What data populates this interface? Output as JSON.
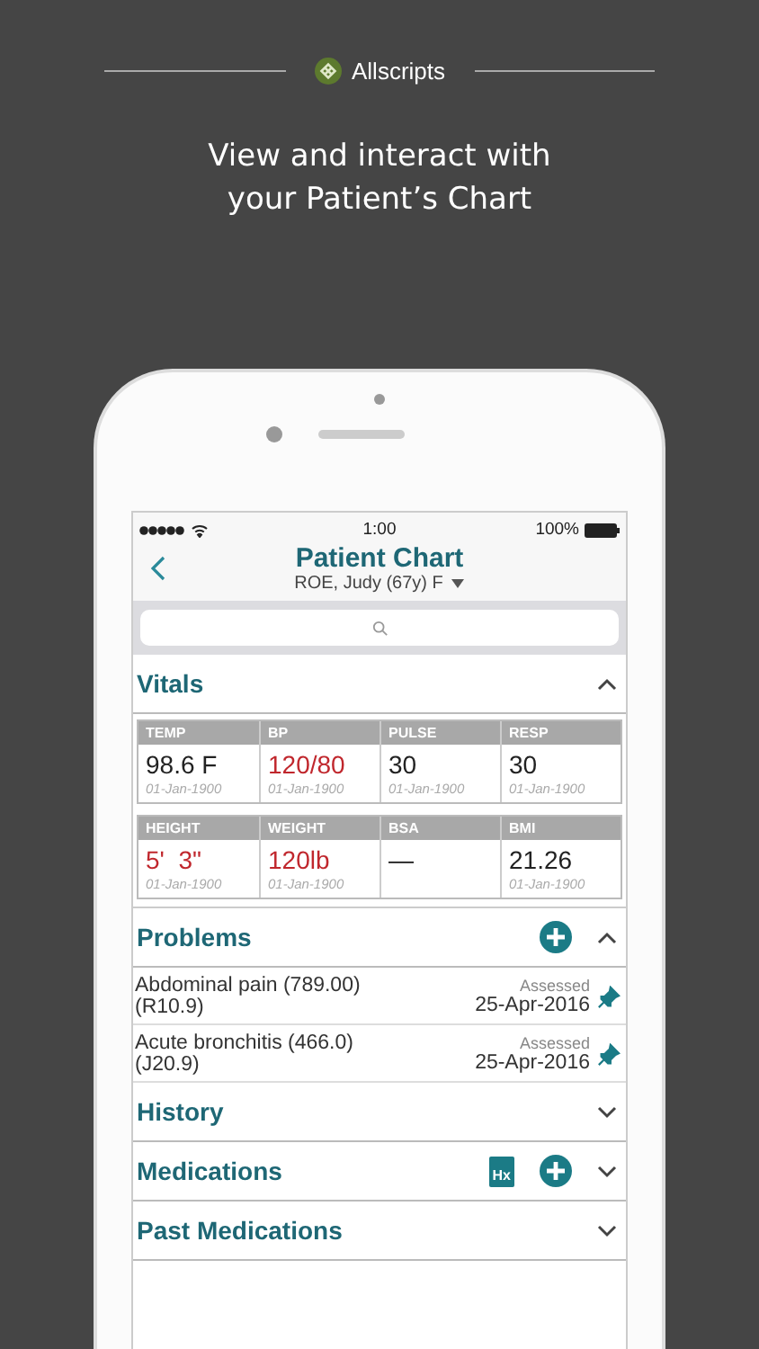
{
  "brand": {
    "name": "Allscripts"
  },
  "headline": [
    "View and interact with",
    "your Patient’s Chart"
  ],
  "status_bar": {
    "time": "1:00",
    "battery": "100%"
  },
  "nav": {
    "title": "Patient Chart",
    "subtitle": "ROE, Judy (67y) F"
  },
  "sections": [
    {
      "kind": "vitals",
      "title": "Vitals",
      "expanded": true,
      "groups": [
        [
          {
            "label": "TEMP",
            "value": "98.6 F",
            "date": "01-Jan-1900",
            "abnormal": false
          },
          {
            "label": "BP",
            "value": "120/80",
            "date": "01-Jan-1900",
            "abnormal": true
          },
          {
            "label": "PULSE",
            "value": "30",
            "date": "01-Jan-1900",
            "abnormal": false
          },
          {
            "label": "RESP",
            "value": "30",
            "date": "01-Jan-1900",
            "abnormal": false
          }
        ],
        [
          {
            "label": "HEIGHT",
            "value": "5'  3\"",
            "date": "01-Jan-1900",
            "abnormal": true
          },
          {
            "label": "WEIGHT",
            "value": "120lb",
            "date": "01-Jan-1900",
            "abnormal": true
          },
          {
            "label": "BSA",
            "value": "—",
            "abnormal": false
          },
          {
            "label": "BMI",
            "value": "21.26",
            "date": "01-Jan-1900",
            "abnormal": false
          }
        ]
      ]
    },
    {
      "kind": "problems",
      "title": "Problems",
      "expanded": true,
      "actions": [
        {
          "kind": "add"
        }
      ],
      "rows": [
        {
          "name": "Abdominal pain (789.00)",
          "code": "(R10.9)",
          "status": "Assessed",
          "date": "25-Apr-2016"
        },
        {
          "name": "Acute bronchitis (466.0)",
          "code": "(J20.9)",
          "status": "Assessed",
          "date": "25-Apr-2016"
        }
      ]
    },
    {
      "title": "History",
      "expanded": false
    },
    {
      "title": "Medications",
      "expanded": false,
      "actions": [
        {
          "kind": "history",
          "label": "Hx"
        },
        {
          "kind": "add"
        }
      ]
    },
    {
      "title": "Past Medications",
      "expanded": false
    }
  ]
}
